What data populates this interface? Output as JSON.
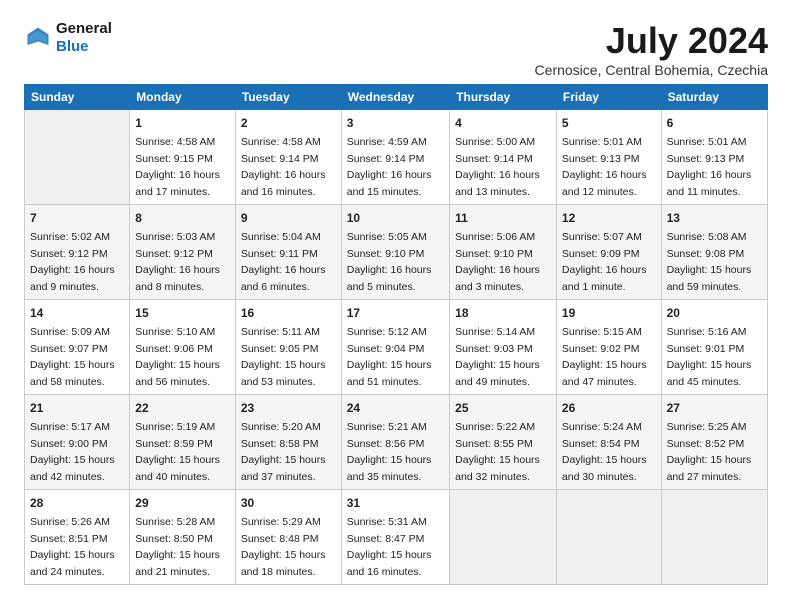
{
  "header": {
    "logo_line1": "General",
    "logo_line2": "Blue",
    "month": "July 2024",
    "location": "Cernosice, Central Bohemia, Czechia"
  },
  "days_of_week": [
    "Sunday",
    "Monday",
    "Tuesday",
    "Wednesday",
    "Thursday",
    "Friday",
    "Saturday"
  ],
  "weeks": [
    [
      {
        "day": "",
        "sunrise": "",
        "sunset": "",
        "daylight": "",
        "empty": true
      },
      {
        "day": "1",
        "sunrise": "Sunrise: 4:58 AM",
        "sunset": "Sunset: 9:15 PM",
        "daylight": "Daylight: 16 hours and 17 minutes."
      },
      {
        "day": "2",
        "sunrise": "Sunrise: 4:58 AM",
        "sunset": "Sunset: 9:14 PM",
        "daylight": "Daylight: 16 hours and 16 minutes."
      },
      {
        "day": "3",
        "sunrise": "Sunrise: 4:59 AM",
        "sunset": "Sunset: 9:14 PM",
        "daylight": "Daylight: 16 hours and 15 minutes."
      },
      {
        "day": "4",
        "sunrise": "Sunrise: 5:00 AM",
        "sunset": "Sunset: 9:14 PM",
        "daylight": "Daylight: 16 hours and 13 minutes."
      },
      {
        "day": "5",
        "sunrise": "Sunrise: 5:01 AM",
        "sunset": "Sunset: 9:13 PM",
        "daylight": "Daylight: 16 hours and 12 minutes."
      },
      {
        "day": "6",
        "sunrise": "Sunrise: 5:01 AM",
        "sunset": "Sunset: 9:13 PM",
        "daylight": "Daylight: 16 hours and 11 minutes."
      }
    ],
    [
      {
        "day": "7",
        "sunrise": "Sunrise: 5:02 AM",
        "sunset": "Sunset: 9:12 PM",
        "daylight": "Daylight: 16 hours and 9 minutes."
      },
      {
        "day": "8",
        "sunrise": "Sunrise: 5:03 AM",
        "sunset": "Sunset: 9:12 PM",
        "daylight": "Daylight: 16 hours and 8 minutes."
      },
      {
        "day": "9",
        "sunrise": "Sunrise: 5:04 AM",
        "sunset": "Sunset: 9:11 PM",
        "daylight": "Daylight: 16 hours and 6 minutes."
      },
      {
        "day": "10",
        "sunrise": "Sunrise: 5:05 AM",
        "sunset": "Sunset: 9:10 PM",
        "daylight": "Daylight: 16 hours and 5 minutes."
      },
      {
        "day": "11",
        "sunrise": "Sunrise: 5:06 AM",
        "sunset": "Sunset: 9:10 PM",
        "daylight": "Daylight: 16 hours and 3 minutes."
      },
      {
        "day": "12",
        "sunrise": "Sunrise: 5:07 AM",
        "sunset": "Sunset: 9:09 PM",
        "daylight": "Daylight: 16 hours and 1 minute."
      },
      {
        "day": "13",
        "sunrise": "Sunrise: 5:08 AM",
        "sunset": "Sunset: 9:08 PM",
        "daylight": "Daylight: 15 hours and 59 minutes."
      }
    ],
    [
      {
        "day": "14",
        "sunrise": "Sunrise: 5:09 AM",
        "sunset": "Sunset: 9:07 PM",
        "daylight": "Daylight: 15 hours and 58 minutes."
      },
      {
        "day": "15",
        "sunrise": "Sunrise: 5:10 AM",
        "sunset": "Sunset: 9:06 PM",
        "daylight": "Daylight: 15 hours and 56 minutes."
      },
      {
        "day": "16",
        "sunrise": "Sunrise: 5:11 AM",
        "sunset": "Sunset: 9:05 PM",
        "daylight": "Daylight: 15 hours and 53 minutes."
      },
      {
        "day": "17",
        "sunrise": "Sunrise: 5:12 AM",
        "sunset": "Sunset: 9:04 PM",
        "daylight": "Daylight: 15 hours and 51 minutes."
      },
      {
        "day": "18",
        "sunrise": "Sunrise: 5:14 AM",
        "sunset": "Sunset: 9:03 PM",
        "daylight": "Daylight: 15 hours and 49 minutes."
      },
      {
        "day": "19",
        "sunrise": "Sunrise: 5:15 AM",
        "sunset": "Sunset: 9:02 PM",
        "daylight": "Daylight: 15 hours and 47 minutes."
      },
      {
        "day": "20",
        "sunrise": "Sunrise: 5:16 AM",
        "sunset": "Sunset: 9:01 PM",
        "daylight": "Daylight: 15 hours and 45 minutes."
      }
    ],
    [
      {
        "day": "21",
        "sunrise": "Sunrise: 5:17 AM",
        "sunset": "Sunset: 9:00 PM",
        "daylight": "Daylight: 15 hours and 42 minutes."
      },
      {
        "day": "22",
        "sunrise": "Sunrise: 5:19 AM",
        "sunset": "Sunset: 8:59 PM",
        "daylight": "Daylight: 15 hours and 40 minutes."
      },
      {
        "day": "23",
        "sunrise": "Sunrise: 5:20 AM",
        "sunset": "Sunset: 8:58 PM",
        "daylight": "Daylight: 15 hours and 37 minutes."
      },
      {
        "day": "24",
        "sunrise": "Sunrise: 5:21 AM",
        "sunset": "Sunset: 8:56 PM",
        "daylight": "Daylight: 15 hours and 35 minutes."
      },
      {
        "day": "25",
        "sunrise": "Sunrise: 5:22 AM",
        "sunset": "Sunset: 8:55 PM",
        "daylight": "Daylight: 15 hours and 32 minutes."
      },
      {
        "day": "26",
        "sunrise": "Sunrise: 5:24 AM",
        "sunset": "Sunset: 8:54 PM",
        "daylight": "Daylight: 15 hours and 30 minutes."
      },
      {
        "day": "27",
        "sunrise": "Sunrise: 5:25 AM",
        "sunset": "Sunset: 8:52 PM",
        "daylight": "Daylight: 15 hours and 27 minutes."
      }
    ],
    [
      {
        "day": "28",
        "sunrise": "Sunrise: 5:26 AM",
        "sunset": "Sunset: 8:51 PM",
        "daylight": "Daylight: 15 hours and 24 minutes."
      },
      {
        "day": "29",
        "sunrise": "Sunrise: 5:28 AM",
        "sunset": "Sunset: 8:50 PM",
        "daylight": "Daylight: 15 hours and 21 minutes."
      },
      {
        "day": "30",
        "sunrise": "Sunrise: 5:29 AM",
        "sunset": "Sunset: 8:48 PM",
        "daylight": "Daylight: 15 hours and 18 minutes."
      },
      {
        "day": "31",
        "sunrise": "Sunrise: 5:31 AM",
        "sunset": "Sunset: 8:47 PM",
        "daylight": "Daylight: 15 hours and 16 minutes."
      },
      {
        "day": "",
        "sunrise": "",
        "sunset": "",
        "daylight": "",
        "empty": true
      },
      {
        "day": "",
        "sunrise": "",
        "sunset": "",
        "daylight": "",
        "empty": true
      },
      {
        "day": "",
        "sunrise": "",
        "sunset": "",
        "daylight": "",
        "empty": true
      }
    ]
  ]
}
